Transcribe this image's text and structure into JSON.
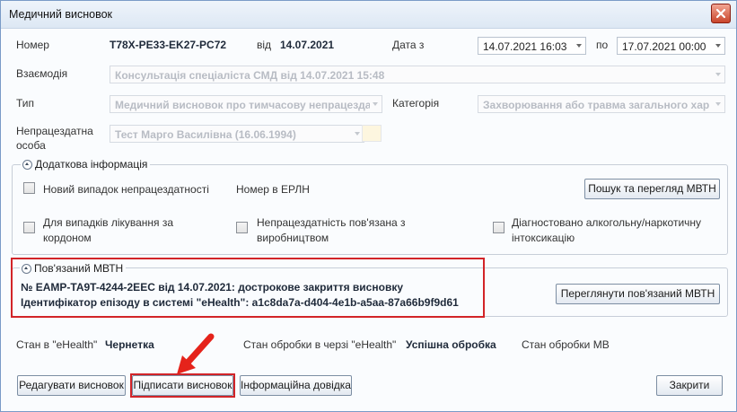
{
  "window": {
    "title": "Медичний висновок"
  },
  "header": {
    "number_label": "Номер",
    "number_value": "T78X-PE33-EK27-PC72",
    "from_label": "від",
    "from_value": "14.07.2021",
    "date_from_label": "Дата з",
    "date_from_value": "14.07.2021 16:03",
    "to_label": "по",
    "date_to_value": "17.07.2021 00:00"
  },
  "fields": {
    "interaction_label": "Взаємодія",
    "interaction_value": "Консультація спеціаліста СМД від 14.07.2021 15:48",
    "type_label": "Тип",
    "type_value": "Медичний висновок про тимчасову непрацездатність",
    "category_label": "Категорія",
    "category_value": "Захворювання або травма загального характеру",
    "person_label_1": "Непрацездатна",
    "person_label_2": "особа",
    "person_value": "Тест Марго Василівна (16.06.1994)"
  },
  "additional": {
    "title": "Додаткова інформація",
    "new_case": "Новий випадок непрацездатності",
    "erln_label": "Номер в ЕРЛН",
    "search_button": "Пошук та перегляд МВТН",
    "abroad_1": "Для випадків лікування за",
    "abroad_2": "кордоном",
    "production_1": "Непрацездатність пов'язана з",
    "production_2": "виробництвом",
    "alcohol_1": "Діагностовано алкогольну/наркотичну",
    "alcohol_2": "інтоксикацію"
  },
  "related": {
    "title": "Пов'язаний МВТН",
    "line1": "№ EAMP-TA9T-4244-2EEC від 14.07.2021: дострокове закриття висновку",
    "line2": "Ідентифікатор епізоду в системі \"eHealth\": a1c8da7a-d404-4e1b-a5aa-87a66b9f9d61",
    "view_button": "Переглянути пов'язаний МВТН"
  },
  "status": {
    "ehealth_label": "Стан в \"eHealth\"",
    "ehealth_value": "Чернетка",
    "queue_label": "Стан обробки в черзі \"eHealth\"",
    "queue_value": "Успішна обробка",
    "mv_label": "Стан обробки МВ"
  },
  "buttons": {
    "edit": "Редагувати висновок",
    "sign": "Підписати висновок",
    "info": "Інформаційна довідка",
    "close": "Закрити"
  },
  "colors": {
    "highlight": "#d22428",
    "arrow": "#e5231b"
  }
}
